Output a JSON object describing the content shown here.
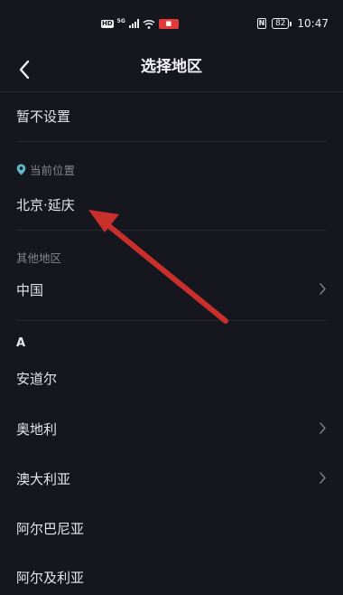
{
  "status_bar": {
    "left_badges": [
      "HD",
      "5G"
    ],
    "battery": "82",
    "time": "10:47"
  },
  "header": {
    "title": "选择地区",
    "back_icon": "chevron-left-icon"
  },
  "no_setting": {
    "label": "暂不设置"
  },
  "current_location": {
    "section_label": "当前位置",
    "icon": "location-pin-icon",
    "value": "北京·延庆"
  },
  "other_regions": {
    "section_label": "其他地区",
    "items": [
      {
        "label": "中国",
        "has_chevron": true
      }
    ]
  },
  "index_letter": "A",
  "regions": [
    {
      "label": "安道尔",
      "has_chevron": false
    },
    {
      "label": "奥地利",
      "has_chevron": true
    },
    {
      "label": "澳大利亚",
      "has_chevron": true
    },
    {
      "label": "阿尔巴尼亚",
      "has_chevron": false
    },
    {
      "label": "阿尔及利亚",
      "has_chevron": false
    }
  ],
  "colors": {
    "background": "#16161f",
    "divider": "#2a2a35",
    "location_pin": "#5fb8cc",
    "annotation_arrow": "#c9302c"
  }
}
